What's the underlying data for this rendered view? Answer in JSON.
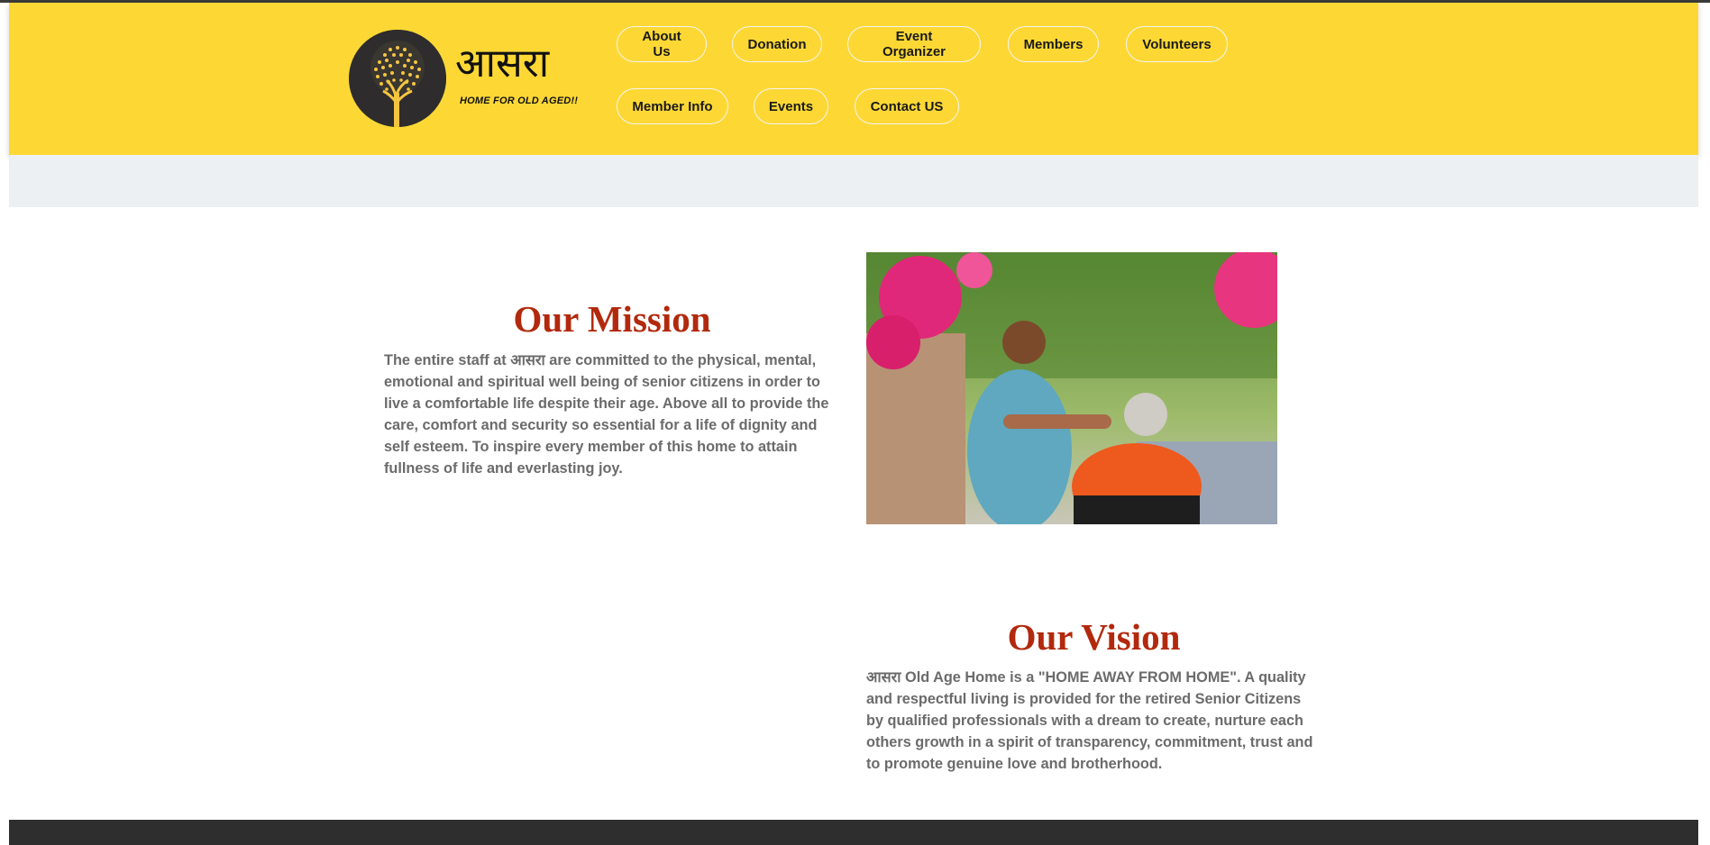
{
  "brand": {
    "name": "आसरा",
    "tagline": "HOME FOR OLD AGED!!",
    "logo_icon": "tree-icon"
  },
  "nav": {
    "row1": [
      "About Us",
      "Donation",
      "Event Organizer",
      "Members",
      "Volunteers"
    ],
    "row2": [
      "Member Info",
      "Events",
      "Contact US"
    ]
  },
  "mission": {
    "title": "Our Mission",
    "text": "The entire staff at आसरा are committed to the physical, mental, emotional and spiritual well being of senior citizens in order to live a comfortable life despite their age. Above all to provide the care, comfort and security so essential for a life of dignity and self esteem. To inspire every member of this home to attain fullness of life and everlasting joy."
  },
  "vision": {
    "title": "Our Vision",
    "text": "आसरा Old Age Home is a \"HOME AWAY FROM HOME\". A quality and respectful living is provided for the retired Senior Citizens by qualified professionals with a dream to create, nurture each others growth in a spirit of transparency, commitment, trust and to promote genuine love and brotherhood."
  },
  "colors": {
    "header": "#fdd835",
    "title": "#b2290d",
    "body_text": "#6b6b6b",
    "band": "#edf0f3",
    "footer": "#2e2e2e"
  }
}
